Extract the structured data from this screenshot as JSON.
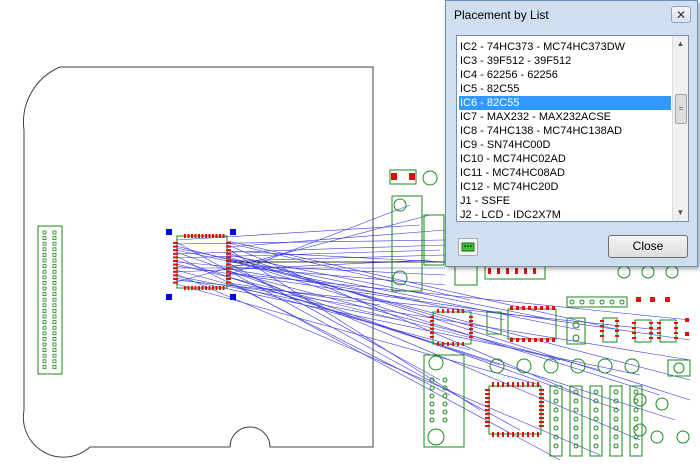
{
  "dialog": {
    "title": "Placement by List",
    "close_glyph": "✕",
    "close_button_label": "Close",
    "footprint_button_icon": "footprint-icon",
    "items": [
      {
        "label": "IC2 - 74HC373 - MC74HC373DW",
        "selected": false
      },
      {
        "label": "IC3 - 39F512 - 39F512",
        "selected": false
      },
      {
        "label": "IC4 - 62256 - 62256",
        "selected": false
      },
      {
        "label": "IC5 - 82C55",
        "selected": false
      },
      {
        "label": "IC6 - 82C55",
        "selected": true
      },
      {
        "label": "IC7 - MAX232 - MAX232ACSE",
        "selected": false
      },
      {
        "label": "IC8 - 74HC138 - MC74HC138AD",
        "selected": false
      },
      {
        "label": "IC9 - SN74HC00D",
        "selected": false
      },
      {
        "label": "IC10 - MC74HC02AD",
        "selected": false
      },
      {
        "label": "IC11 - MC74HC08AD",
        "selected": false
      },
      {
        "label": "IC12 - MC74HC20D",
        "selected": false
      },
      {
        "label": "J1 - SSFE",
        "selected": false
      },
      {
        "label": "J2 - LCD - IDC2X7M",
        "selected": false
      }
    ]
  },
  "colors": {
    "board_outline": "#404040",
    "ratsnest": "#3b3bdf",
    "footprint_green": "#1b8a1b",
    "pad_red": "#e01010",
    "handle_blue": "#0000ff",
    "selection": "#3399ff",
    "dialog_frame": "#cfdff0"
  }
}
